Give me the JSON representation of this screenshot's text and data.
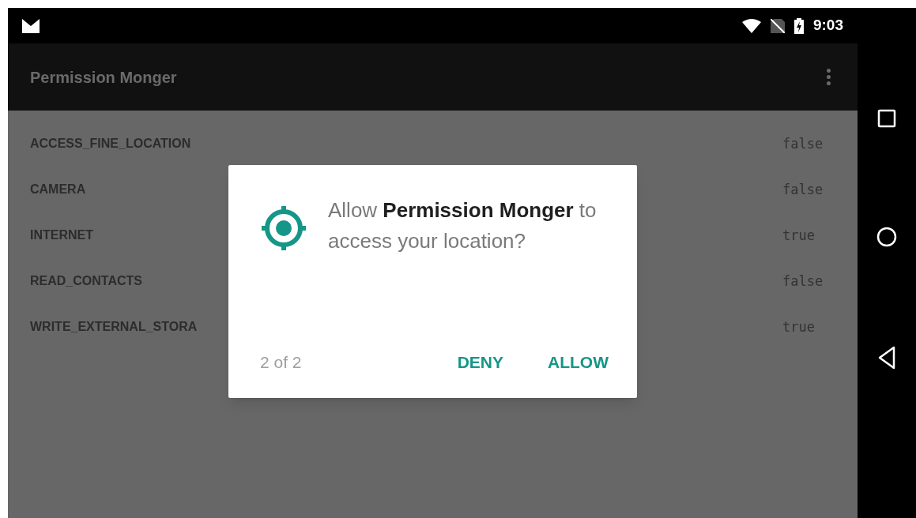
{
  "status_bar": {
    "time": "9:03"
  },
  "app_bar": {
    "title": "Permission Monger"
  },
  "permissions": [
    {
      "name": "ACCESS_FINE_LOCATION",
      "value": "false"
    },
    {
      "name": "CAMERA",
      "value": "false"
    },
    {
      "name": "INTERNET",
      "value": "true"
    },
    {
      "name": "READ_CONTACTS",
      "value": "false"
    },
    {
      "name": "WRITE_EXTERNAL_STORA",
      "value": "true"
    }
  ],
  "dialog": {
    "message": "Allow **Permission Monger** to access your location?",
    "counter": "2 of 2",
    "buttons": [
      "DENY",
      "ALLOW"
    ]
  }
}
